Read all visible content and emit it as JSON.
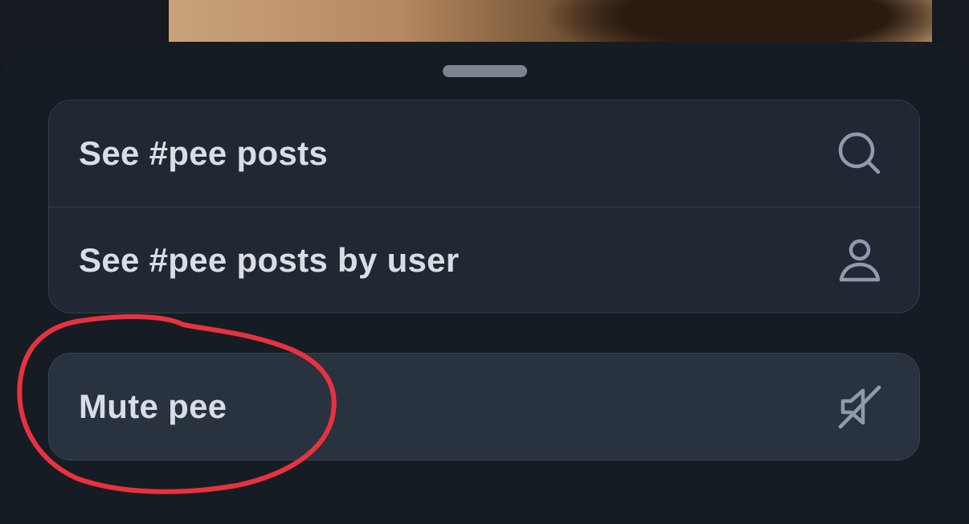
{
  "sheet": {
    "actions": [
      {
        "label": "See #pee posts",
        "icon": "search-icon"
      },
      {
        "label": "See #pee posts by user",
        "icon": "user-icon"
      }
    ],
    "mute": {
      "label": "Mute pee",
      "icon": "mute-icon"
    }
  },
  "colors": {
    "sheet_background": "#161c24",
    "group_background": "#212834",
    "mute_background": "#29323f",
    "text": "#d9dee5",
    "icon": "#8f9bac",
    "annotation": "#e8323f"
  }
}
